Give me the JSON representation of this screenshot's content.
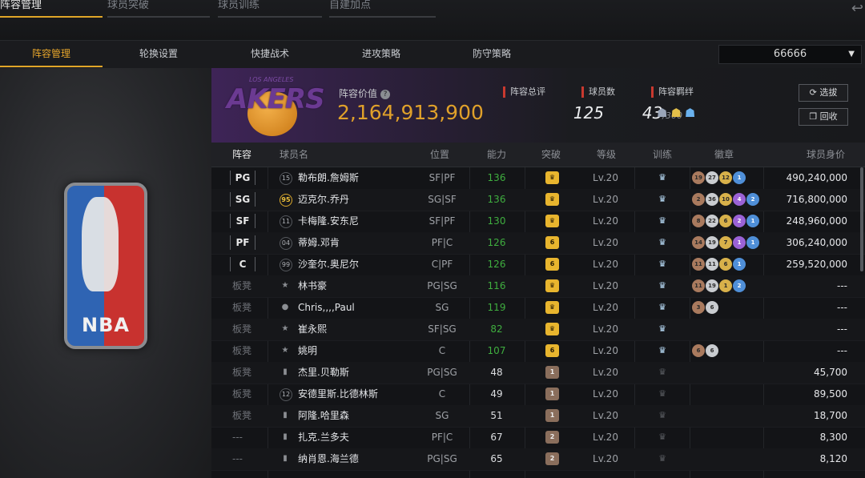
{
  "top_tabs": [
    "阵容管理",
    "球员突破",
    "球员训练",
    "自建加点"
  ],
  "sub_tabs": [
    "阵容管理",
    "轮换设置",
    "快捷战术",
    "进攻策略",
    "防守策略"
  ],
  "dropdown": {
    "value": "66666"
  },
  "team": {
    "logo_word": "AKERS",
    "logo_sup": "LOS ANGELES"
  },
  "summary": {
    "value_label": "阵容价值",
    "value": "2,164,913,900",
    "rating_label": "阵容总评",
    "rating": "125",
    "count_label": "球员数",
    "count": "43",
    "count_max": "/300",
    "synergy_label": "阵容羁绊"
  },
  "buttons": {
    "pick": "选拔",
    "recycle": "回收"
  },
  "headers": [
    "阵容",
    "球员名",
    "位置",
    "能力",
    "突破",
    "等级",
    "训练",
    "徽章",
    "球员身价"
  ],
  "rows": [
    {
      "slot": "PG",
      "num": "15",
      "name": "勒布朗.詹姆斯",
      "pos": "SF|PF",
      "abl": "136",
      "abl_green": true,
      "brk": "♛",
      "brk_type": "y",
      "lv": "Lv.20",
      "train": true,
      "badges": [
        [
          "br",
          "19"
        ],
        [
          "sv",
          "27"
        ],
        [
          "gd",
          "12"
        ],
        [
          "bl",
          "1"
        ]
      ],
      "value": "490,240,000"
    },
    {
      "slot": "SG",
      "num": "95",
      "name": "迈克尔.乔丹",
      "pos": "SG|SF",
      "abl": "136",
      "abl_green": true,
      "brk": "♛",
      "brk_type": "y",
      "lv": "Lv.20",
      "train": true,
      "badges": [
        [
          "br",
          "2"
        ],
        [
          "sv",
          "36"
        ],
        [
          "gd",
          "10"
        ],
        [
          "pu",
          "4"
        ],
        [
          "bl",
          "2"
        ]
      ],
      "value": "716,800,000"
    },
    {
      "slot": "SF",
      "num": "11",
      "name": "卡梅隆.安东尼",
      "pos": "SF|PF",
      "abl": "130",
      "abl_green": true,
      "brk": "♛",
      "brk_type": "y",
      "lv": "Lv.20",
      "train": true,
      "badges": [
        [
          "br",
          "8"
        ],
        [
          "sv",
          "22"
        ],
        [
          "gd",
          "6"
        ],
        [
          "pu",
          "2"
        ],
        [
          "bl",
          "1"
        ]
      ],
      "value": "248,960,000"
    },
    {
      "slot": "PF",
      "num": "04",
      "name": "蒂姆.邓肯",
      "pos": "PF|C",
      "abl": "126",
      "abl_green": true,
      "brk": "6",
      "brk_type": "y",
      "lv": "Lv.20",
      "train": true,
      "badges": [
        [
          "br",
          "14"
        ],
        [
          "sv",
          "19"
        ],
        [
          "gd",
          "7"
        ],
        [
          "pu",
          "1"
        ],
        [
          "bl",
          "1"
        ]
      ],
      "value": "306,240,000"
    },
    {
      "slot": "C",
      "num": "99",
      "name": "沙奎尔.奥尼尔",
      "pos": "C|PF",
      "abl": "126",
      "abl_green": true,
      "brk": "6",
      "brk_type": "y",
      "lv": "Lv.20",
      "train": true,
      "badges": [
        [
          "br",
          "11"
        ],
        [
          "sv",
          "11"
        ],
        [
          "gd",
          "6"
        ],
        [
          "bl",
          "1"
        ]
      ],
      "value": "259,520,000"
    },
    {
      "slot": "板凳",
      "num": "★",
      "name": "林书豪",
      "pos": "PG|SG",
      "abl": "116",
      "abl_green": true,
      "brk": "♛",
      "brk_type": "y",
      "lv": "Lv.20",
      "train": true,
      "badges": [
        [
          "br",
          "11"
        ],
        [
          "sv",
          "19"
        ],
        [
          "gd",
          "1"
        ],
        [
          "bl",
          "2"
        ]
      ],
      "value": "---"
    },
    {
      "slot": "板凳",
      "num": "●",
      "name": "Chris,,,,Paul",
      "pos": "SG",
      "abl": "119",
      "abl_green": true,
      "brk": "♛",
      "brk_type": "y",
      "lv": "Lv.20",
      "train": true,
      "badges": [
        [
          "br",
          "3"
        ],
        [
          "sv",
          "6"
        ]
      ],
      "value": "---"
    },
    {
      "slot": "板凳",
      "num": "★",
      "name": "崔永熙",
      "pos": "SF|SG",
      "abl": "82",
      "abl_green": true,
      "brk": "♛",
      "brk_type": "y",
      "lv": "Lv.20",
      "train": true,
      "badges": [],
      "value": "---"
    },
    {
      "slot": "板凳",
      "num": "★",
      "name": "姚明",
      "pos": "C",
      "abl": "107",
      "abl_green": true,
      "brk": "6",
      "brk_type": "y",
      "lv": "Lv.20",
      "train": true,
      "badges": [
        [
          "br",
          "6"
        ],
        [
          "sv",
          "6"
        ]
      ],
      "value": "---"
    },
    {
      "slot": "板凳",
      "num": "▮",
      "name": "杰里.贝勒斯",
      "pos": "PG|SG",
      "abl": "48",
      "abl_green": false,
      "brk": "1",
      "brk_type": "b",
      "lv": "Lv.20",
      "train": false,
      "badges": [],
      "value": "45,700"
    },
    {
      "slot": "板凳",
      "num": "12",
      "name": "安德里斯.比德林斯",
      "pos": "C",
      "abl": "49",
      "abl_green": false,
      "brk": "1",
      "brk_type": "b",
      "lv": "Lv.20",
      "train": false,
      "badges": [],
      "value": "89,500"
    },
    {
      "slot": "板凳",
      "num": "▮",
      "name": "阿隆.哈里森",
      "pos": "SG",
      "abl": "51",
      "abl_green": false,
      "brk": "1",
      "brk_type": "b",
      "lv": "Lv.20",
      "train": false,
      "badges": [],
      "value": "18,700"
    },
    {
      "slot": "---",
      "num": "▮",
      "name": "扎克.兰多夫",
      "pos": "PF|C",
      "abl": "67",
      "abl_green": false,
      "brk": "2",
      "brk_type": "b",
      "lv": "Lv.20",
      "train": false,
      "badges": [],
      "value": "8,300"
    },
    {
      "slot": "---",
      "num": "▮",
      "name": "纳肖恩.海兰德",
      "pos": "PG|SG",
      "abl": "65",
      "abl_green": false,
      "brk": "2",
      "brk_type": "b",
      "lv": "Lv.20",
      "train": false,
      "badges": [],
      "value": "8,120"
    }
  ]
}
